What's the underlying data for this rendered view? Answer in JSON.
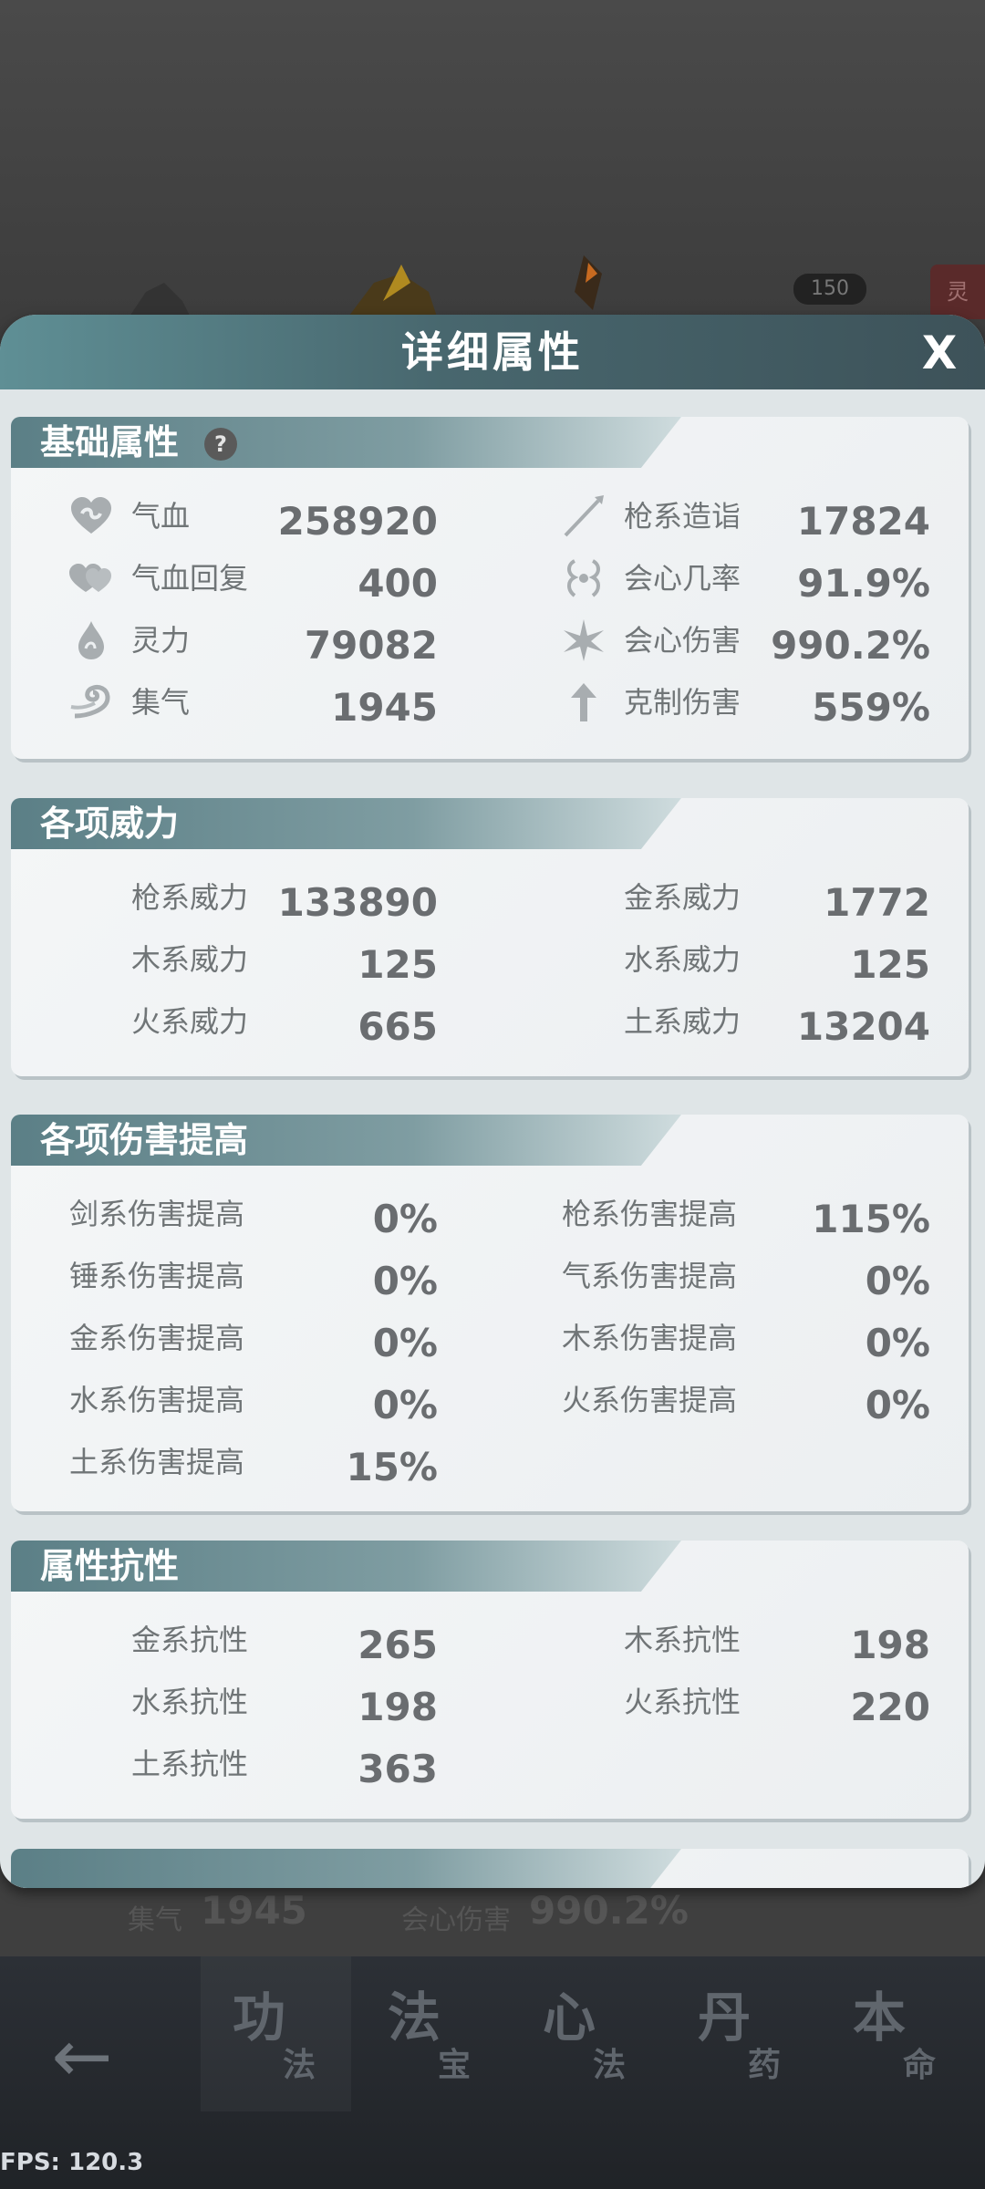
{
  "window_title": "详细属性",
  "close_label": "X",
  "background": {
    "badge": "150",
    "red_tag": "灵",
    "peek_stats": [
      {
        "label": "集气",
        "value": "1945"
      },
      {
        "label": "会心伤害",
        "value": "990.2%"
      }
    ]
  },
  "sections": {
    "basic": {
      "title": "基础属性",
      "help": "?",
      "left": [
        {
          "label": "气血",
          "value": "258920",
          "icon": "heart-icon"
        },
        {
          "label": "气血回复",
          "value": "400",
          "icon": "heart-regen-icon"
        },
        {
          "label": "灵力",
          "value": "79082",
          "icon": "spirit-drop-icon"
        },
        {
          "label": "集气",
          "value": "1945",
          "icon": "swirl-icon"
        }
      ],
      "right": [
        {
          "label": "枪系造诣",
          "value": "17824",
          "icon": "spear-icon"
        },
        {
          "label": "会心几率",
          "value": "91.9%",
          "icon": "crit-rate-icon"
        },
        {
          "label": "会心伤害",
          "value": "990.2%",
          "icon": "crit-burst-icon"
        },
        {
          "label": "克制伤害",
          "value": "559%",
          "icon": "counter-arrow-icon"
        }
      ]
    },
    "power": {
      "title": "各项威力",
      "left": [
        {
          "label": "枪系威力",
          "value": "133890"
        },
        {
          "label": "木系威力",
          "value": "125"
        },
        {
          "label": "火系威力",
          "value": "665"
        }
      ],
      "right": [
        {
          "label": "金系威力",
          "value": "1772"
        },
        {
          "label": "水系威力",
          "value": "125"
        },
        {
          "label": "土系威力",
          "value": "13204"
        }
      ]
    },
    "damage": {
      "title": "各项伤害提高",
      "left": [
        {
          "label": "剑系伤害提高",
          "value": "0%"
        },
        {
          "label": "锤系伤害提高",
          "value": "0%"
        },
        {
          "label": "金系伤害提高",
          "value": "0%"
        },
        {
          "label": "水系伤害提高",
          "value": "0%"
        },
        {
          "label": "土系伤害提高",
          "value": "15%"
        }
      ],
      "right": [
        {
          "label": "枪系伤害提高",
          "value": "115%"
        },
        {
          "label": "气系伤害提高",
          "value": "0%"
        },
        {
          "label": "木系伤害提高",
          "value": "0%"
        },
        {
          "label": "火系伤害提高",
          "value": "0%"
        }
      ]
    },
    "resist": {
      "title": "属性抗性",
      "left": [
        {
          "label": "金系抗性",
          "value": "265"
        },
        {
          "label": "水系抗性",
          "value": "198"
        },
        {
          "label": "土系抗性",
          "value": "363"
        }
      ],
      "right": [
        {
          "label": "木系抗性",
          "value": "198"
        },
        {
          "label": "火系抗性",
          "value": "220"
        }
      ]
    }
  },
  "bottom_nav": {
    "back": "←",
    "tabs": [
      {
        "big": "功",
        "small": "法"
      },
      {
        "big": "法",
        "small": "宝"
      },
      {
        "big": "心",
        "small": "法"
      },
      {
        "big": "丹",
        "small": "药"
      },
      {
        "big": "本",
        "small": "命"
      }
    ]
  },
  "fps": "FPS: 120.3"
}
